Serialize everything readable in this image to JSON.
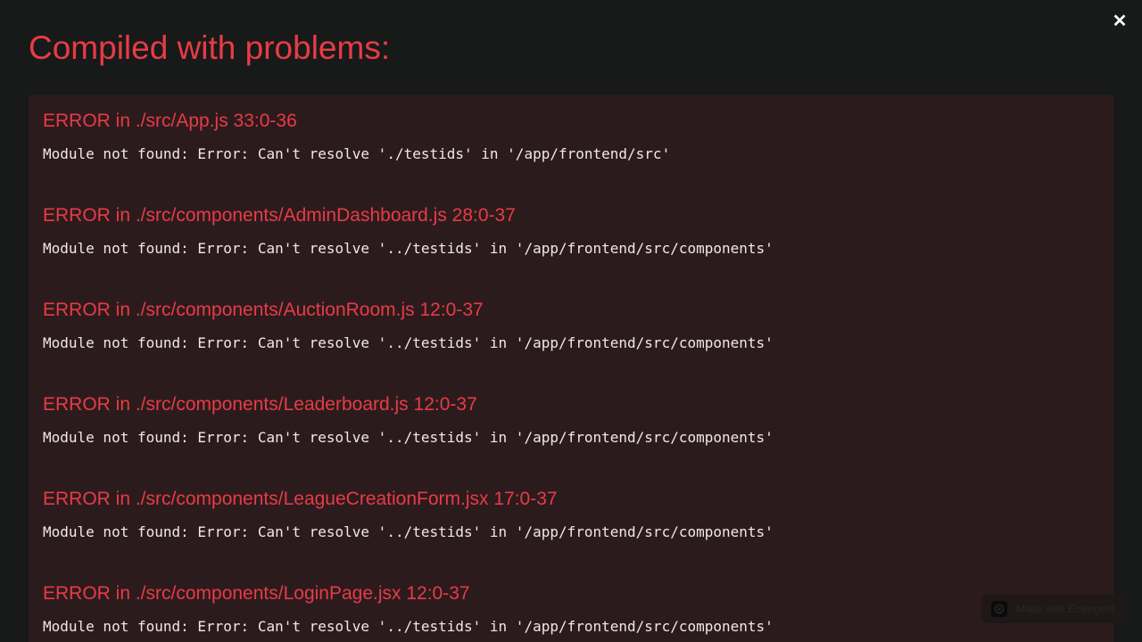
{
  "overlay": {
    "title": "Compiled with problems:",
    "close_label": "✕"
  },
  "errors": [
    {
      "heading": "ERROR in ./src/App.js 33:0-36",
      "message": "Module not found: Error: Can't resolve './testids' in '/app/frontend/src'"
    },
    {
      "heading": "ERROR in ./src/components/AdminDashboard.js 28:0-37",
      "message": "Module not found: Error: Can't resolve '../testids' in '/app/frontend/src/components'"
    },
    {
      "heading": "ERROR in ./src/components/AuctionRoom.js 12:0-37",
      "message": "Module not found: Error: Can't resolve '../testids' in '/app/frontend/src/components'"
    },
    {
      "heading": "ERROR in ./src/components/Leaderboard.js 12:0-37",
      "message": "Module not found: Error: Can't resolve '../testids' in '/app/frontend/src/components'"
    },
    {
      "heading": "ERROR in ./src/components/LeagueCreationForm.jsx 17:0-37",
      "message": "Module not found: Error: Can't resolve '../testids' in '/app/frontend/src/components'"
    },
    {
      "heading": "ERROR in ./src/components/LoginPage.jsx 12:0-37",
      "message": "Module not found: Error: Can't resolve '../testids' in '/app/frontend/src/components'"
    }
  ],
  "badge": {
    "label": "Made with Emergent",
    "icon": "emergent-logo-icon"
  },
  "colors": {
    "background": "#181a1a",
    "panel": "#2c1b1d",
    "error_red": "#e83b46",
    "message_text": "#f0e8e8"
  }
}
